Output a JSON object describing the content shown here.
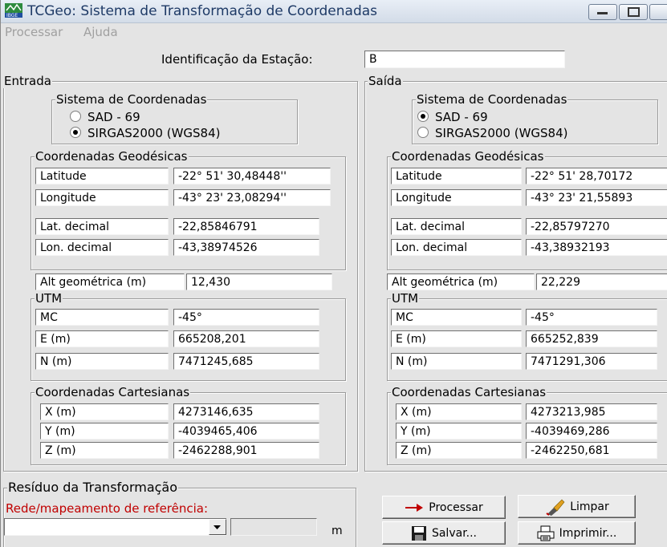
{
  "window": {
    "title": "TCGeo: Sistema de Transformação de Coordenadas"
  },
  "menu": [
    "Processar",
    "Ajuda"
  ],
  "station": {
    "label": "Identificação da Estação:",
    "value": "B"
  },
  "entrada": {
    "title": "Entrada",
    "sistema": {
      "title": "Sistema de Coordenadas",
      "options": [
        "SAD - 69",
        "SIRGAS2000 (WGS84)"
      ],
      "selected": 1
    },
    "geodesicas": {
      "title": "Coordenadas Geodésicas",
      "rows": [
        {
          "label": "Latitude",
          "value": "-22° 51' 30,48448''"
        },
        {
          "label": "Longitude",
          "value": "-43° 23' 23,08294''"
        },
        {
          "label": "Lat. decimal",
          "value": "-22,85846791"
        },
        {
          "label": "Lon. decimal",
          "value": "-43,38974526"
        }
      ]
    },
    "alt": {
      "label": "Alt geométrica (m)",
      "value": "12,430"
    },
    "utm": {
      "title": "UTM",
      "rows": [
        {
          "label": "MC",
          "value": "-45°"
        },
        {
          "label": "E (m)",
          "value": "665208,201"
        },
        {
          "label": "N (m)",
          "value": "7471245,685"
        }
      ]
    },
    "cartesianas": {
      "title": "Coordenadas Cartesianas",
      "rows": [
        {
          "label": "X (m)",
          "value": "4273146,635"
        },
        {
          "label": "Y (m)",
          "value": "-4039465,406"
        },
        {
          "label": "Z (m)",
          "value": "-2462288,901"
        }
      ]
    }
  },
  "saida": {
    "title": "Saída",
    "sistema": {
      "title": "Sistema de Coordenadas",
      "options": [
        "SAD - 69",
        "SIRGAS2000 (WGS84)"
      ],
      "selected": 0
    },
    "geodesicas": {
      "title": "Coordenadas Geodésicas",
      "rows": [
        {
          "label": "Latitude",
          "value": "-22° 51' 28,70172"
        },
        {
          "label": "Longitude",
          "value": "-43° 23' 21,55893"
        },
        {
          "label": "Lat. decimal",
          "value": "-22,85797270"
        },
        {
          "label": "Lon. decimal",
          "value": "-43,38932193"
        }
      ]
    },
    "alt": {
      "label": "Alt geométrica (m)",
      "value": "22,229"
    },
    "utm": {
      "title": "UTM",
      "rows": [
        {
          "label": "MC",
          "value": "-45°"
        },
        {
          "label": "E (m)",
          "value": "665252,839"
        },
        {
          "label": "N (m)",
          "value": "7471291,306"
        }
      ]
    },
    "cartesianas": {
      "title": "Coordenadas Cartesianas",
      "rows": [
        {
          "label": "X (m)",
          "value": "4273213,985"
        },
        {
          "label": "Y (m)",
          "value": "-4039469,286"
        },
        {
          "label": "Z (m)",
          "value": "-2462250,681"
        }
      ]
    }
  },
  "residuo": {
    "title": "Resíduo da Transformação",
    "rede_label": "Rede/mapeamento de referência:",
    "unit": "m",
    "value": ""
  },
  "buttons": {
    "processar": "Processar",
    "limpar": "Limpar",
    "salvar": "Salvar...",
    "imprimir": "Imprimir..."
  },
  "colors": {
    "accent_red": "#c00000",
    "title_text": "#1e3a66",
    "menu_disabled": "#a0a0a0"
  }
}
